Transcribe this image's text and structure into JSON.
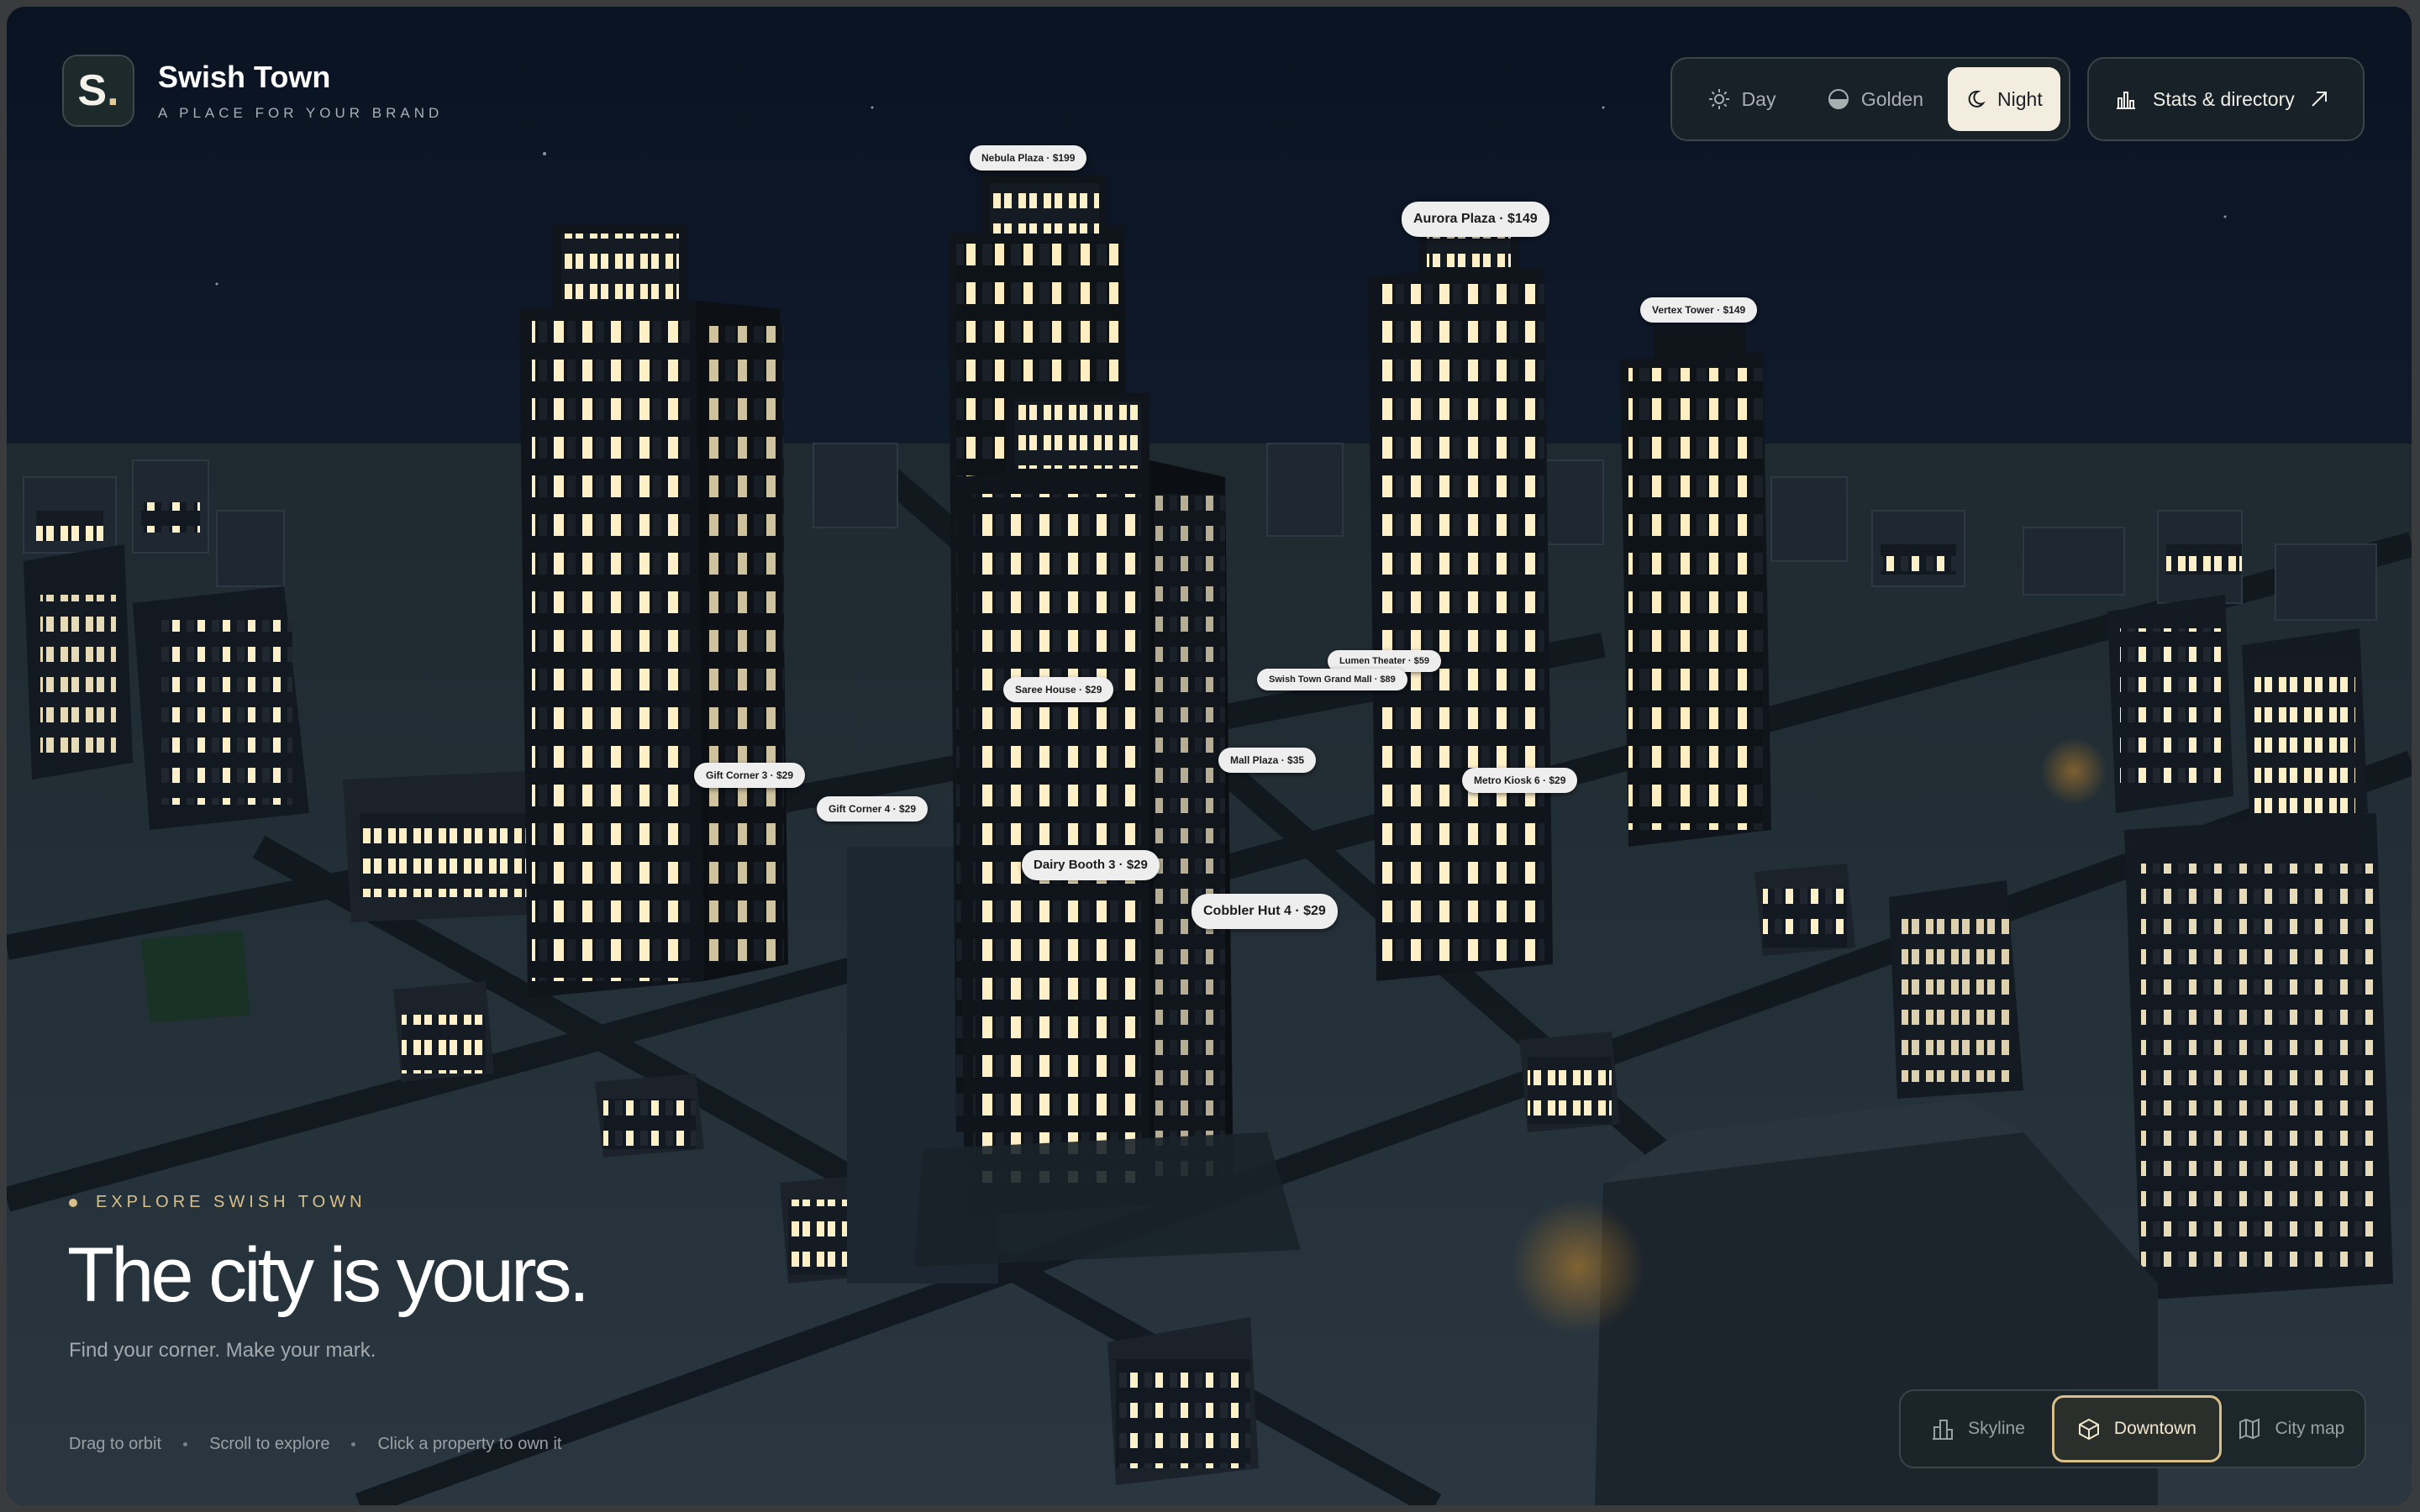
{
  "brand": {
    "logo": "S",
    "title": "Swish Town",
    "tagline": "A PLACE FOR YOUR BRAND"
  },
  "modes": [
    {
      "label": "Day",
      "icon": "sun-icon",
      "active": false
    },
    {
      "label": "Golden",
      "icon": "half-sun-icon",
      "active": false
    },
    {
      "label": "Night",
      "icon": "moon-icon",
      "active": true
    }
  ],
  "stats_button": {
    "label": "Stats & directory",
    "icon": "bar-chart-icon",
    "trailing_icon": "arrow-up-right-icon"
  },
  "property_labels": [
    "Nebula Plaza · $199",
    "Aurora Plaza · $149",
    "Vertex Tower · $149",
    "Lumen Theater · $59",
    "Swish Town Grand Mall · $89",
    "Saree House · $29",
    "Mall Plaza · $35",
    "Metro Kiosk 6 · $29",
    "Gift Corner 3 · $29",
    "Gift Corner 4 · $29",
    "Dairy Booth 3 · $29",
    "Cobbler Hut 4 · $29"
  ],
  "explore": {
    "eyebrow": "EXPLORE SWISH TOWN",
    "headline": "The city is yours.",
    "subtitle": "Find your corner. Make your mark."
  },
  "hints": [
    "Drag to orbit",
    "Scroll to explore",
    "Click a property to own it"
  ],
  "views": [
    {
      "label": "Skyline",
      "icon": "skyline-icon",
      "active": false
    },
    {
      "label": "Downtown",
      "icon": "cube-icon",
      "active": true
    },
    {
      "label": "City map",
      "icon": "map-icon",
      "active": false
    }
  ],
  "colors": {
    "sky": "#0a1322",
    "ground": "#2e3944",
    "window_glow": "#fff0c8",
    "accent": "#d9c08a",
    "active_mode_bg": "#f3eddf"
  }
}
